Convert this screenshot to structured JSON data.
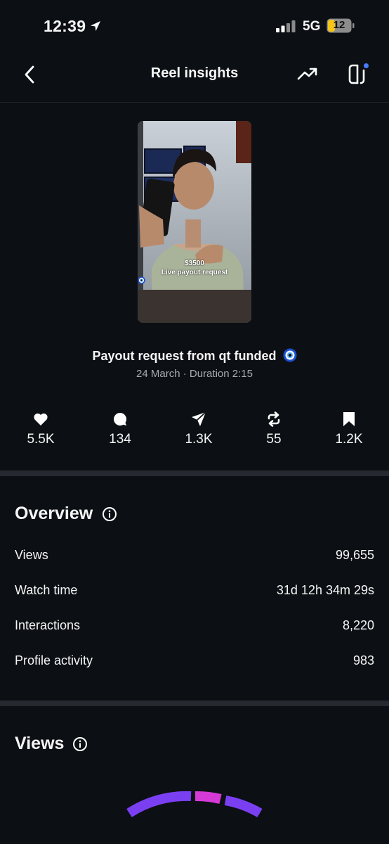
{
  "status_bar": {
    "time": "12:39",
    "network": "5G",
    "battery": "12"
  },
  "header": {
    "title": "Reel insights"
  },
  "reel": {
    "thumbnail_caption_amount": "$3500",
    "thumbnail_caption_text": "Live payout request",
    "title": "Payout request from qt funded",
    "meta": "24 March · Duration 2:15"
  },
  "stats": [
    {
      "icon": "heart-icon",
      "value": "5.5K"
    },
    {
      "icon": "comment-icon",
      "value": "134"
    },
    {
      "icon": "send-icon",
      "value": "1.3K"
    },
    {
      "icon": "repost-icon",
      "value": "55"
    },
    {
      "icon": "bookmark-icon",
      "value": "1.2K"
    }
  ],
  "overview": {
    "title": "Overview",
    "rows": [
      {
        "label": "Views",
        "value": "99,655"
      },
      {
        "label": "Watch time",
        "value": "31d 12h 34m 29s"
      },
      {
        "label": "Interactions",
        "value": "8,220"
      },
      {
        "label": "Profile activity",
        "value": "983"
      }
    ]
  },
  "views": {
    "title": "Views"
  },
  "colors": {
    "background": "#0c1014",
    "divider": "#262a30",
    "accent_purple": "#7b3ff2",
    "accent_pink": "#d63ad6",
    "notification_dot": "#4a7cff",
    "battery_fill": "#f5c518"
  }
}
